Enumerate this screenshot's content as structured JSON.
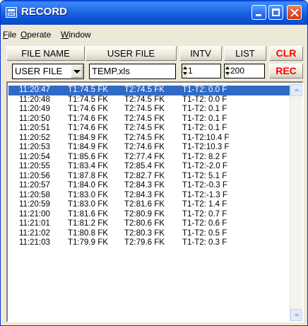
{
  "window": {
    "title": "RECORD",
    "icon": "record-app-icon",
    "accent": "#0a5fd8",
    "close_color": "#d8522e"
  },
  "menu": {
    "items": [
      {
        "label": "File",
        "mnemonic": "F"
      },
      {
        "label": "Operate",
        "mnemonic": "O"
      },
      {
        "label": "Window",
        "mnemonic": "W"
      }
    ]
  },
  "toolbar": {
    "file_name_label": "FILE NAME",
    "user_file_label": "USER FILE",
    "intv_label": "INTV",
    "list_label": "LIST",
    "clr_label": "CLR",
    "rec_label": "REC",
    "action_color": "#ff0000"
  },
  "controls": {
    "file_type_value": "USER FILE",
    "file_name_value": "TEMP.xls",
    "interval_value": "1",
    "list_value": "200"
  },
  "log": {
    "selected_index": 0,
    "selected_color": "#316ac5",
    "rows": [
      {
        "time": "11:20:47",
        "t1": "T1:74.5 FK",
        "t2": "T2:74.5 FK",
        "diff": "T1-T2: 0.0 F"
      },
      {
        "time": "11:20:48",
        "t1": "T1:74.5 FK",
        "t2": "T2:74.5 FK",
        "diff": "T1-T2: 0.0 F"
      },
      {
        "time": "11:20:49",
        "t1": "T1:74.6 FK",
        "t2": "T2:74.5 FK",
        "diff": "T1-T2: 0.1 F"
      },
      {
        "time": "11:20:50",
        "t1": "T1:74.6 FK",
        "t2": "T2:74.5 FK",
        "diff": "T1-T2: 0.1 F"
      },
      {
        "time": "11:20:51",
        "t1": "T1:74.6 FK",
        "t2": "T2:74.5 FK",
        "diff": "T1-T2: 0.1 F"
      },
      {
        "time": "11:20:52",
        "t1": "T1:84.9 FK",
        "t2": "T2:74.5 FK",
        "diff": "T1-T2:10.4 F"
      },
      {
        "time": "11:20:53",
        "t1": "T1:84.9 FK",
        "t2": "T2:74.6 FK",
        "diff": "T1-T2:10.3 F"
      },
      {
        "time": "11:20:54",
        "t1": "T1:85.6 FK",
        "t2": "T2:77.4 FK",
        "diff": "T1-T2: 8.2 F"
      },
      {
        "time": "11:20:55",
        "t1": "T1:83.4 FK",
        "t2": "T2:85.4 FK",
        "diff": "T1-T2:-2.0 F"
      },
      {
        "time": "11:20:56",
        "t1": "T1:87.8 FK",
        "t2": "T2:82.7 FK",
        "diff": "T1-T2: 5.1 F"
      },
      {
        "time": "11:20:57",
        "t1": "T1:84.0 FK",
        "t2": "T2:84.3 FK",
        "diff": "T1-T2:-0.3 F"
      },
      {
        "time": "11:20:58",
        "t1": "T1:83.0 FK",
        "t2": "T2:84.3 FK",
        "diff": "T1-T2:-1.3 F"
      },
      {
        "time": "11:20:59",
        "t1": "T1:83.0 FK",
        "t2": "T2:81.6 FK",
        "diff": "T1-T2: 1.4 F"
      },
      {
        "time": "11:21:00",
        "t1": "T1:81.6 FK",
        "t2": "T2:80.9 FK",
        "diff": "T1-T2: 0.7 F"
      },
      {
        "time": "11:21:01",
        "t1": "T1:81.2 FK",
        "t2": "T2:80.6 FK",
        "diff": "T1-T2: 0.6 F"
      },
      {
        "time": "11:21:02",
        "t1": "T1:80.8 FK",
        "t2": "T2:80.3 FK",
        "diff": "T1-T2: 0.5 F"
      },
      {
        "time": "11:21:03",
        "t1": "T1:79.9 FK",
        "t2": "T2:79.6 FK",
        "diff": "T1-T2: 0.3 F"
      }
    ]
  }
}
